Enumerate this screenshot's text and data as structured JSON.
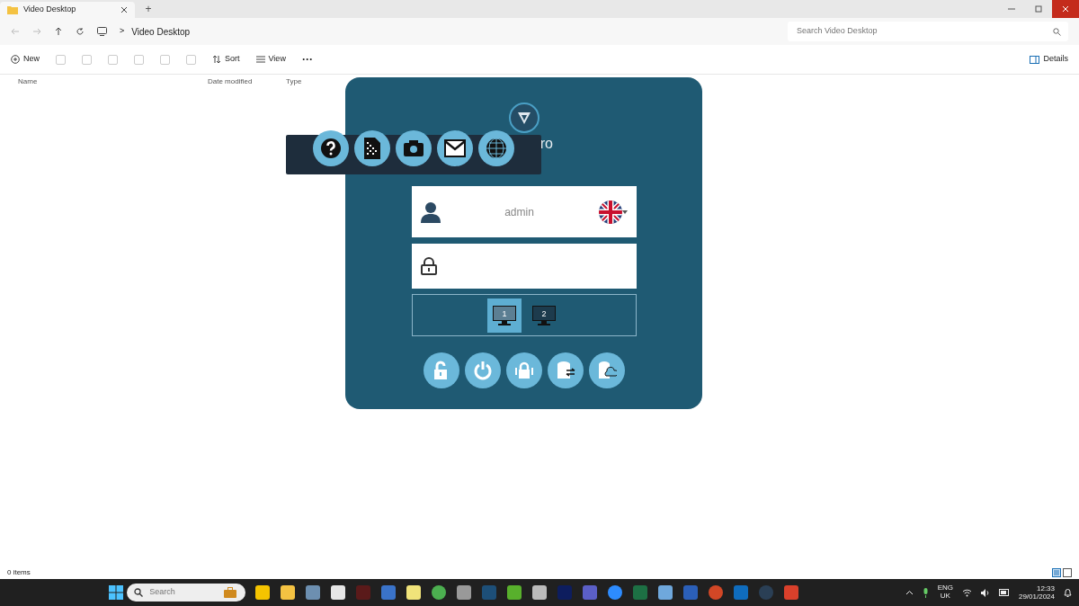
{
  "window": {
    "tab_title": "Video Desktop",
    "new_tab": "+"
  },
  "address_bar": {
    "path": "Video Desktop",
    "separator": ">",
    "search_placeholder": "Search Video Desktop"
  },
  "command_bar": {
    "new": "New",
    "sort": "Sort",
    "view": "View",
    "more": "···",
    "details": "Details"
  },
  "columns": [
    "Name",
    "Date modified",
    "Type"
  ],
  "status_bar": "0 items",
  "login": {
    "title_fragment": "ro",
    "username": "admin",
    "screens": [
      {
        "label": "1",
        "selected": true
      },
      {
        "label": "2",
        "selected": false
      }
    ]
  },
  "taskbar": {
    "search_placeholder": "Search",
    "language": "ENG",
    "region": "UK",
    "time": "12:33",
    "date": "29/01/2024"
  }
}
